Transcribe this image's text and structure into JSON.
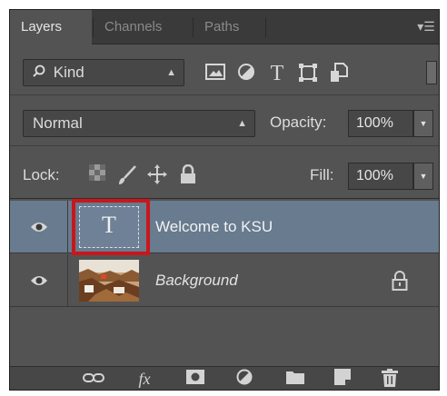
{
  "tabs": [
    {
      "label": "Layers",
      "active": true
    },
    {
      "label": "Channels",
      "active": false
    },
    {
      "label": "Paths",
      "active": false
    }
  ],
  "panel_menu_icon": "panel-menu-icon",
  "filter": {
    "kind_label": "Kind",
    "icons": [
      "pixel-layer-filter-icon",
      "adjustment-layer-filter-icon",
      "type-layer-filter-icon",
      "shape-layer-filter-icon",
      "smart-object-filter-icon"
    ],
    "type_glyph": "T"
  },
  "blend": {
    "mode": "Normal",
    "opacity_label": "Opacity:",
    "opacity_value": "100%"
  },
  "lock": {
    "label": "Lock:",
    "fill_label": "Fill:",
    "fill_value": "100%",
    "icons": [
      "lock-transparent-pixels-icon",
      "lock-image-pixels-icon",
      "lock-position-icon",
      "lock-all-icon"
    ]
  },
  "layers": [
    {
      "name": "Welcome to KSU",
      "type": "text",
      "thumb_glyph": "T",
      "selected": true,
      "visible": true,
      "locked": false
    },
    {
      "name": "Background",
      "type": "image",
      "selected": false,
      "visible": true,
      "locked": true
    }
  ],
  "bottom_icons": [
    "link-layers-icon",
    "layer-style-icon",
    "add-mask-icon",
    "adjustment-layer-icon",
    "new-group-icon",
    "new-layer-icon",
    "delete-layer-icon"
  ],
  "colors": {
    "panel_bg": "#535353",
    "tab_bar_bg": "#3a3a3a",
    "selected_row": "#687b8f",
    "highlight_border": "#c8171c"
  }
}
